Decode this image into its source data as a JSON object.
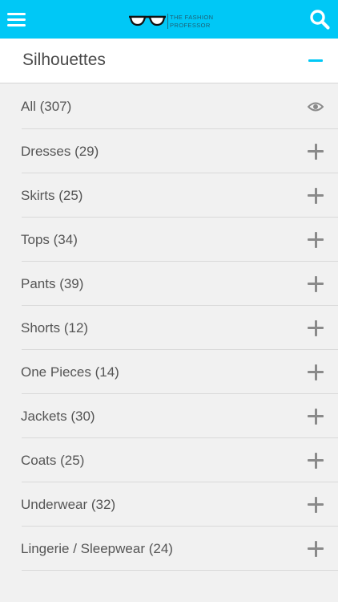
{
  "header": {
    "logo_line1": "THE FASHION",
    "logo_line2": "PROFESSOR",
    "menu_icon": "hamburger-menu-icon",
    "search_icon": "search-icon",
    "accent_color": "#00c8f6"
  },
  "section": {
    "title": "Silhouettes",
    "toggle_icon": "minus-icon"
  },
  "categories": [
    {
      "label": "All (307)",
      "icon": "eye-icon"
    },
    {
      "label": "Dresses (29)",
      "icon": "plus-icon"
    },
    {
      "label": "Skirts (25)",
      "icon": "plus-icon"
    },
    {
      "label": "Tops (34)",
      "icon": "plus-icon"
    },
    {
      "label": "Pants (39)",
      "icon": "plus-icon"
    },
    {
      "label": "Shorts (12)",
      "icon": "plus-icon"
    },
    {
      "label": "One Pieces (14)",
      "icon": "plus-icon"
    },
    {
      "label": "Jackets (30)",
      "icon": "plus-icon"
    },
    {
      "label": "Coats (25)",
      "icon": "plus-icon"
    },
    {
      "label": "Underwear (32)",
      "icon": "plus-icon"
    },
    {
      "label": "Lingerie / Sleepwear (24)",
      "icon": "plus-icon"
    }
  ]
}
